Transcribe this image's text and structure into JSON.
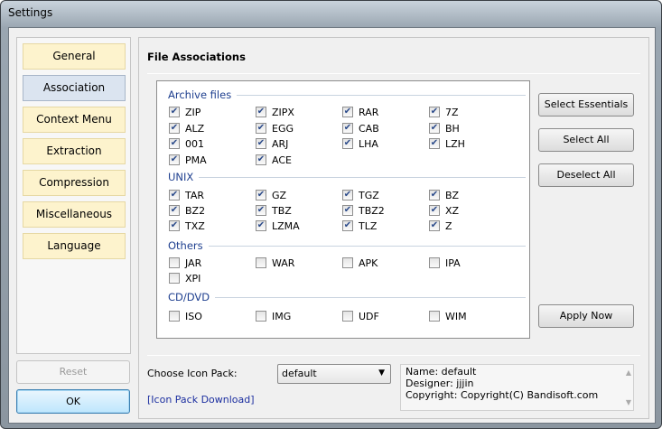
{
  "window": {
    "title": "Settings"
  },
  "sidebar": {
    "items": [
      {
        "label": "General",
        "active": false
      },
      {
        "label": "Association",
        "active": true
      },
      {
        "label": "Context Menu",
        "active": false
      },
      {
        "label": "Extraction",
        "active": false
      },
      {
        "label": "Compression",
        "active": false
      },
      {
        "label": "Miscellaneous",
        "active": false
      },
      {
        "label": "Language",
        "active": false
      }
    ],
    "reset_label": "Reset",
    "ok_label": "OK"
  },
  "main": {
    "title": "File Associations",
    "groups": [
      {
        "label": "Archive files",
        "items": [
          {
            "ext": "ZIP",
            "checked": true
          },
          {
            "ext": "ZIPX",
            "checked": true
          },
          {
            "ext": "RAR",
            "checked": true
          },
          {
            "ext": "7Z",
            "checked": true
          },
          {
            "ext": "ALZ",
            "checked": true
          },
          {
            "ext": "EGG",
            "checked": true
          },
          {
            "ext": "CAB",
            "checked": true
          },
          {
            "ext": "BH",
            "checked": true
          },
          {
            "ext": "001",
            "checked": true
          },
          {
            "ext": "ARJ",
            "checked": true
          },
          {
            "ext": "LHA",
            "checked": true
          },
          {
            "ext": "LZH",
            "checked": true
          },
          {
            "ext": "PMA",
            "checked": true
          },
          {
            "ext": "ACE",
            "checked": true
          }
        ]
      },
      {
        "label": "UNIX",
        "items": [
          {
            "ext": "TAR",
            "checked": true
          },
          {
            "ext": "GZ",
            "checked": true
          },
          {
            "ext": "TGZ",
            "checked": true
          },
          {
            "ext": "BZ",
            "checked": true
          },
          {
            "ext": "BZ2",
            "checked": true
          },
          {
            "ext": "TBZ",
            "checked": true
          },
          {
            "ext": "TBZ2",
            "checked": true
          },
          {
            "ext": "XZ",
            "checked": true
          },
          {
            "ext": "TXZ",
            "checked": true
          },
          {
            "ext": "LZMA",
            "checked": true
          },
          {
            "ext": "TLZ",
            "checked": true
          },
          {
            "ext": "Z",
            "checked": true
          }
        ]
      },
      {
        "label": "Others",
        "items": [
          {
            "ext": "JAR",
            "checked": false
          },
          {
            "ext": "WAR",
            "checked": false
          },
          {
            "ext": "APK",
            "checked": false
          },
          {
            "ext": "IPA",
            "checked": false
          },
          {
            "ext": "XPI",
            "checked": false
          }
        ]
      },
      {
        "label": "CD/DVD",
        "items": [
          {
            "ext": "ISO",
            "checked": false
          },
          {
            "ext": "IMG",
            "checked": false
          },
          {
            "ext": "UDF",
            "checked": false
          },
          {
            "ext": "WIM",
            "checked": false
          }
        ]
      }
    ],
    "buttons": {
      "select_essentials": "Select Essentials",
      "select_all": "Select All",
      "deselect_all": "Deselect All",
      "apply_now": "Apply Now"
    },
    "icon_pack": {
      "label": "Choose Icon Pack:",
      "selected": "default",
      "download_link": "[Icon Pack Download]",
      "info": {
        "name": "Name: default",
        "designer": "Designer: jjjin",
        "copyright": "Copyright: Copyright(C) Bandisoft.com"
      }
    }
  }
}
